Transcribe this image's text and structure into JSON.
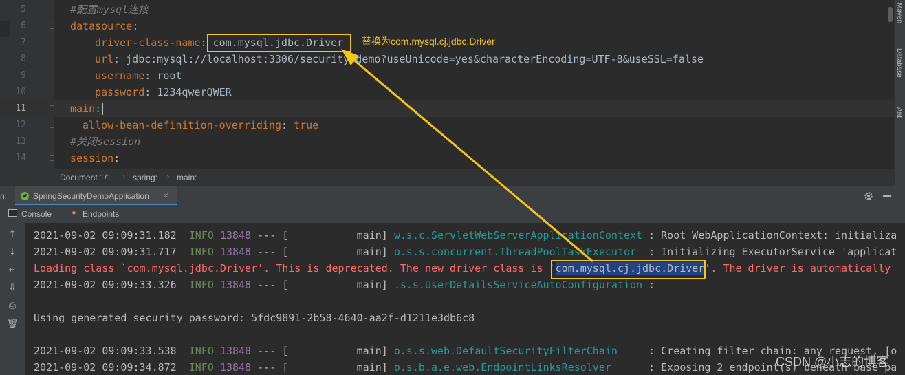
{
  "colors": {
    "editor_bg": "#2b2b2b",
    "gutter_bg": "#313335",
    "keyword": "#cc7832",
    "value": "#a9b7c6",
    "comment": "#808080",
    "info": "#6a8759",
    "pid": "#9876aa",
    "class": "#299999",
    "warning": "#ff6b68",
    "highlight": "#f5c518",
    "selection": "#214283"
  },
  "editor": {
    "lines": [
      {
        "num": "5",
        "key": "",
        "sep": "",
        "val": "",
        "comment": "#配置mysql连接"
      },
      {
        "num": "6",
        "key": "datasource",
        "sep": ":",
        "val": "",
        "comment": ""
      },
      {
        "num": "7",
        "key": "driver-class-name",
        "sep": ": ",
        "val": "com.mysql.jdbc.Driver",
        "comment": ""
      },
      {
        "num": "8",
        "key": "url",
        "sep": ": ",
        "val": "jdbc:mysql://localhost:3306/security_demo?useUnicode=yes&characterEncoding=UTF-8&useSSL=false",
        "comment": ""
      },
      {
        "num": "9",
        "key": "username",
        "sep": ": ",
        "val": "root",
        "comment": ""
      },
      {
        "num": "10",
        "key": "password",
        "sep": ": ",
        "val": "1234qwerQWER",
        "comment": ""
      },
      {
        "num": "11",
        "key": "main",
        "sep": ":",
        "val": "",
        "comment": ""
      },
      {
        "num": "12",
        "key": "allow-bean-definition-overriding",
        "sep": ": ",
        "val": "true",
        "comment": ""
      },
      {
        "num": "13",
        "key": "",
        "sep": "",
        "val": "",
        "comment": "#关闭session"
      },
      {
        "num": "14",
        "key": "session",
        "sep": ":",
        "val": "",
        "comment": ""
      }
    ],
    "annotation": "替换为com.mysql.cj.jdbc.Driver"
  },
  "breadcrumb": [
    "Document 1/1",
    "spring:",
    "main:"
  ],
  "right_tabs": [
    "Maven",
    "Database",
    "Ant"
  ],
  "run": {
    "prefix": "n:",
    "tab_label": "SpringSecurityDemoApplication",
    "tab_close": "×",
    "settings_icon": "gear-icon",
    "minimize_icon": "minimize-icon"
  },
  "tool_tabs": [
    "Console",
    "Endpoints"
  ],
  "console": {
    "lines": [
      {
        "ts": "2021-09-02 09:09:31.182",
        "level": "INFO",
        "pid": "13848",
        "dashes": "---",
        "thread": "[           main]",
        "logger": "w.s.c.ServletWebServerApplicationContext",
        "msg": ": Root WebApplicationContext: initializa"
      },
      {
        "ts": "2021-09-02 09:09:31.717",
        "level": "INFO",
        "pid": "13848",
        "dashes": "---",
        "thread": "[           main]",
        "logger": "o.s.s.concurrent.ThreadPoolTaskExecutor ",
        "msg": ": Initializing ExecutorService 'applicat"
      },
      {
        "warn_pre": "Loading class `com.mysql.jdbc.Driver'. This is deprecated. The new driver class is `",
        "warn_sel": "com.mysql.cj.jdbc.Driver",
        "warn_post": "'. The driver is automatically"
      },
      {
        "ts": "2021-09-02 09:09:33.326",
        "level": "INFO",
        "pid": "13848",
        "dashes": "---",
        "thread": "[           main]",
        "logger": ".s.s.UserDetailsServiceAutoConfiguration",
        "msg": ":"
      },
      {
        "plain": ""
      },
      {
        "plain": "Using generated security password: 5fdc9891-2b58-4640-aa2f-d1211e3db6c8"
      },
      {
        "plain": ""
      },
      {
        "ts": "2021-09-02 09:09:33.538",
        "level": "INFO",
        "pid": "13848",
        "dashes": "---",
        "thread": "[           main]",
        "logger": "o.s.s.web.DefaultSecurityFilterChain    ",
        "msg": ": Creating filter chain: any request, [o"
      },
      {
        "ts": "2021-09-02 09:09:34.872",
        "level": "INFO",
        "pid": "13848",
        "dashes": "---",
        "thread": "[           main]",
        "logger": "o.s.b.a.e.web.EndpointLinksResolver     ",
        "msg": ": Exposing 2 endpoint(s) beneath base pa"
      }
    ]
  },
  "watermark": "CSDN @小志的博客"
}
